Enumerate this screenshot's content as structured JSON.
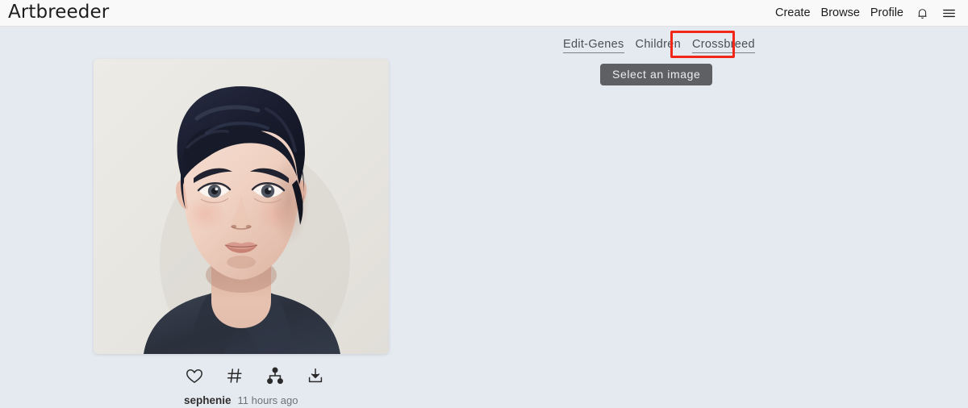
{
  "header": {
    "brand": "Artbreeder",
    "nav": [
      {
        "label": "Create",
        "name": "nav-create"
      },
      {
        "label": "Browse",
        "name": "nav-browse"
      },
      {
        "label": "Profile",
        "name": "nav-profile"
      }
    ],
    "icons": [
      {
        "name": "bell-icon",
        "label": "Notifications"
      },
      {
        "name": "hamburger-menu-icon",
        "label": "Menu"
      }
    ]
  },
  "tabs": [
    {
      "label": "Edit-Genes",
      "underlined": true,
      "highlighted": false
    },
    {
      "label": "Children",
      "underlined": false,
      "highlighted": false
    },
    {
      "label": "Crossbreed",
      "underlined": true,
      "highlighted": true
    }
  ],
  "main": {
    "select_image_label": "Select an image"
  },
  "artwork": {
    "alt": "AI generated portrait of a young man with dark wavy hair",
    "actions": [
      {
        "name": "like-heart-icon",
        "label": "Like"
      },
      {
        "name": "tags-hash-icon",
        "label": "Tags"
      },
      {
        "name": "lineage-tree-icon",
        "label": "Lineage"
      },
      {
        "name": "download-icon",
        "label": "Download"
      }
    ],
    "caption": {
      "username": "sephenie",
      "timestamp": "11 hours ago"
    }
  },
  "colors": {
    "page_background": "#e5e9f0",
    "header_background": "#f9f9f9",
    "text": "#1d1d1d",
    "tab_text": "#4a4f55",
    "highlight_red": "#f22717",
    "button_background": "#5e6063",
    "artwork_background": "#e8e6e0"
  }
}
